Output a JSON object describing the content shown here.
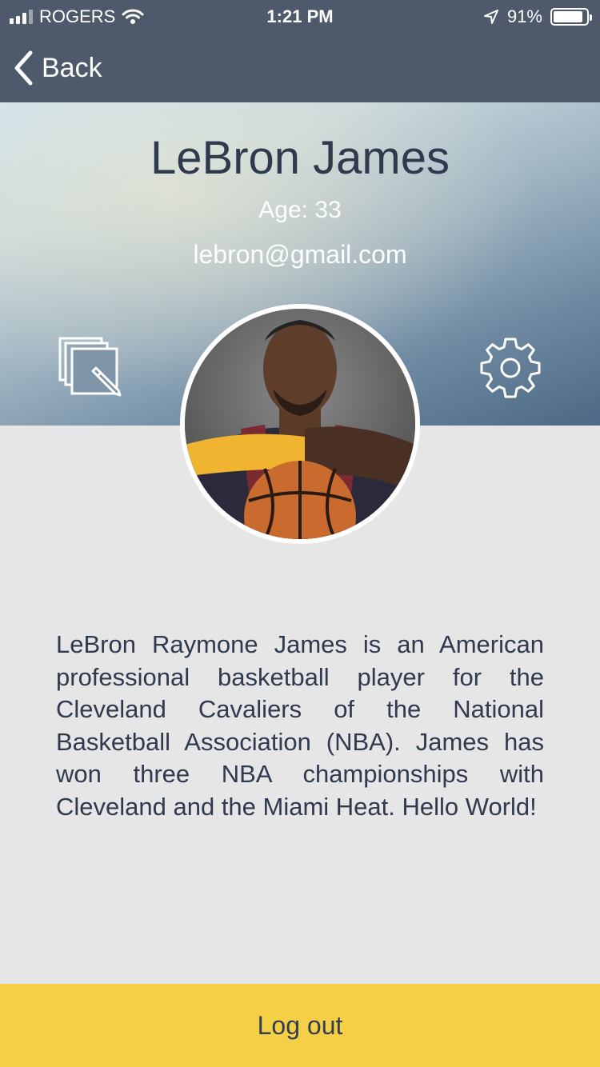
{
  "status_bar": {
    "carrier": "ROGERS",
    "time": "1:21 PM",
    "battery_percent": "91%",
    "signal_bars": 3,
    "battery_level": 0.91
  },
  "nav": {
    "back_label": "Back",
    "back_icon": "chevron-left-icon"
  },
  "profile": {
    "name": "LeBron James",
    "age_label": "Age:",
    "age_value": "33",
    "email": "lebron@gmail.com",
    "edit_icon": "edit-pages-icon",
    "settings_icon": "gear-icon",
    "bio": "LeBron Raymone James is an American professional basketball player for the Cleveland Cavaliers of the National Basketball Association (NBA). James has won three NBA championships with Cleveland and the Miami Heat. Hello World!"
  },
  "footer": {
    "logout_label": "Log out"
  },
  "colors": {
    "topbar": "#4e596b",
    "content_bg": "#e6e6e6",
    "logout_bg": "#f5cf45",
    "text_dark": "#2f3a4e"
  }
}
